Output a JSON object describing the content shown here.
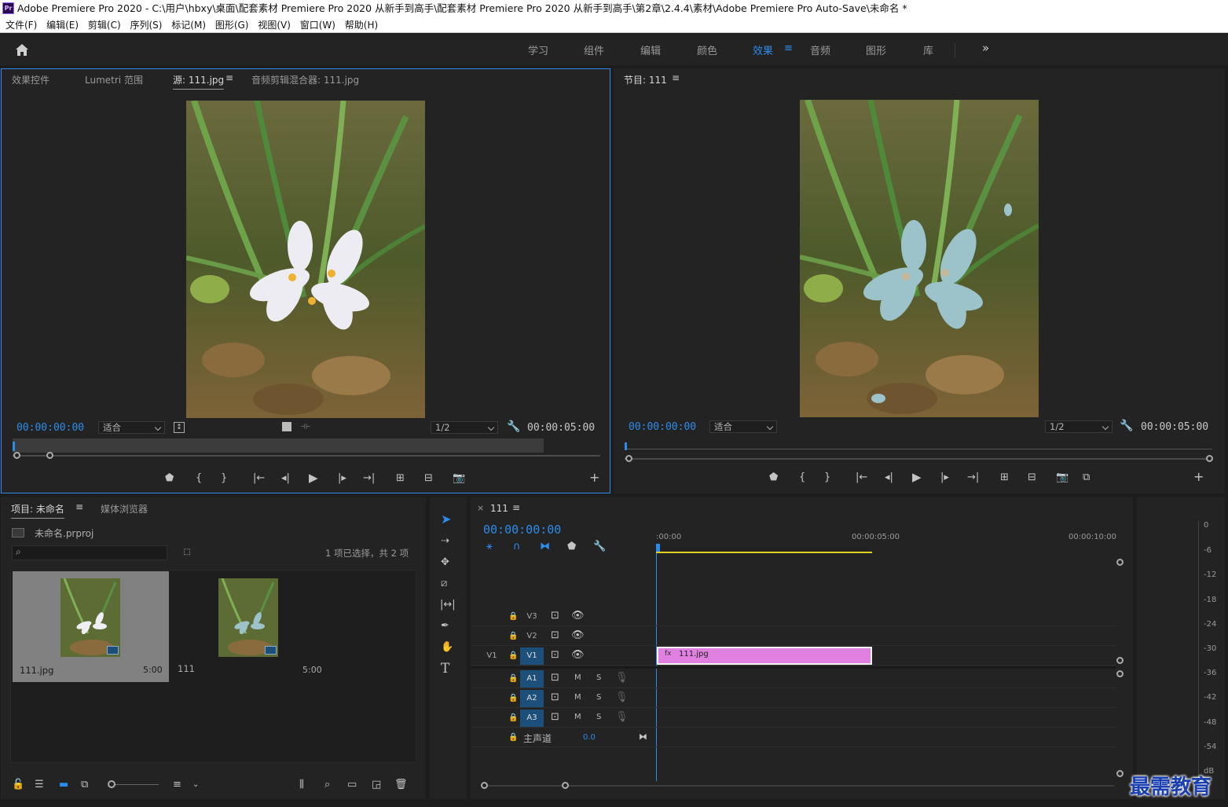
{
  "window": {
    "title": "Adobe Premiere Pro 2020 - C:\\用户\\hbxy\\桌面\\配套素材 Premiere Pro 2020 从新手到高手\\配套素材 Premiere Pro 2020 从新手到高手\\第2章\\2.4.4\\素材\\Adobe Premiere Pro Auto-Save\\未命名 *",
    "logo": "Pr"
  },
  "menu": [
    "文件(F)",
    "编辑(E)",
    "剪辑(C)",
    "序列(S)",
    "标记(M)",
    "图形(G)",
    "视图(V)",
    "窗口(W)",
    "帮助(H)"
  ],
  "workspaces": {
    "items": [
      "学习",
      "组件",
      "编辑",
      "颜色",
      "效果",
      "音频",
      "图形",
      "库"
    ],
    "active": "效果",
    "overflow": "»"
  },
  "source_panel": {
    "tabs": [
      "效果控件",
      "Lumetri 范围",
      "源: 111.jpg",
      "音频剪辑混合器: 111.jpg"
    ],
    "active_tab": "源: 111.jpg",
    "timecode_current": "00:00:00:00",
    "zoom": "适合",
    "resolution": "1/2",
    "timecode_duration": "00:00:05:00"
  },
  "program_panel": {
    "tab": "节目: 111",
    "timecode_current": "00:00:00:00",
    "zoom": "适合",
    "resolution": "1/2",
    "timecode_duration": "00:00:05:00"
  },
  "project_panel": {
    "tabs": [
      "项目: 未命名",
      "媒体浏览器"
    ],
    "project_file": "未命名.prproj",
    "search_placeholder": "",
    "selection_status": "1 项已选择，共 2 项",
    "items": [
      {
        "name": "111.jpg",
        "duration": "5:00",
        "selected": true
      },
      {
        "name": "111",
        "duration": "5:00",
        "selected": false
      }
    ]
  },
  "timeline": {
    "sequence_tab": "111",
    "close": "×",
    "timecode": "00:00:00:00",
    "ruler": [
      ":00:00",
      "00:00:05:00",
      "00:00:10:00"
    ],
    "video_tracks": [
      "V3",
      "V2",
      "V1"
    ],
    "audio_tracks": [
      "A1",
      "A2",
      "A3"
    ],
    "source_patch": "V1",
    "mute": "M",
    "solo": "S",
    "master": {
      "label": "主声道",
      "value": "0.0"
    },
    "clip": {
      "name": "111.jpg",
      "fx": "fx",
      "color": "#e080e0"
    }
  },
  "audio_meter": {
    "scale": [
      "0",
      "-6",
      "-12",
      "-18",
      "-24",
      "-30",
      "-36",
      "-42",
      "-48",
      "-54",
      "dB"
    ]
  },
  "watermark": "最需教育",
  "colors": {
    "accent": "#2d8ceb",
    "panel": "#232323",
    "clip": "#e080e0",
    "work_area": "#e0d020"
  }
}
